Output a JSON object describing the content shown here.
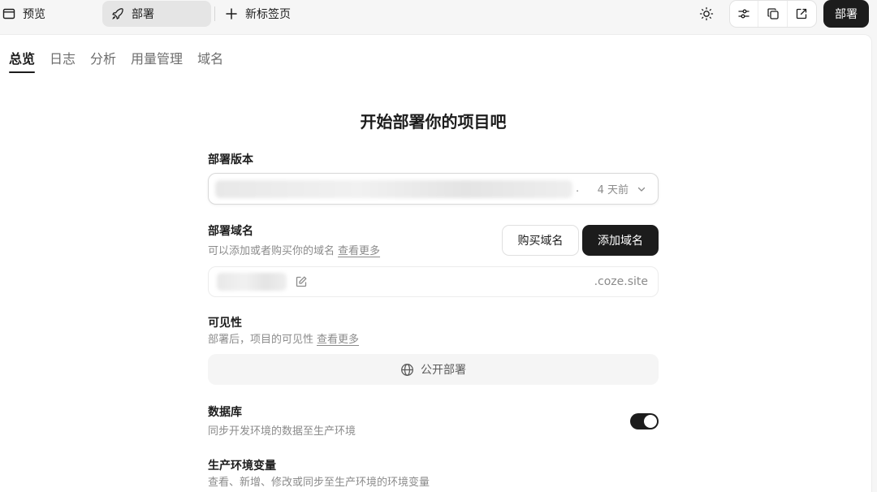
{
  "topbar": {
    "tabs": [
      {
        "label": "预览",
        "icon": "browser-window-icon"
      },
      {
        "label": "部署",
        "icon": "rocket-icon"
      },
      {
        "label": "新标签页",
        "icon": "plus-icon"
      }
    ],
    "actions": [
      "sun-icon",
      "sliders-icon",
      "copy-icon",
      "external-link-icon"
    ],
    "deploy_label": "部署"
  },
  "subtabs": [
    {
      "label": "总览",
      "active": true
    },
    {
      "label": "日志"
    },
    {
      "label": "分析"
    },
    {
      "label": "用量管理"
    },
    {
      "label": "域名"
    }
  ],
  "main": {
    "heading": "开始部署你的项目吧",
    "version": {
      "label": "部署版本",
      "ellipsis": ".",
      "time": "4 天前"
    },
    "domain": {
      "label": "部署域名",
      "desc": "可以添加或者购买你的域名",
      "more": "查看更多",
      "buy_label": "购买域名",
      "add_label": "添加域名",
      "suffix": ".coze.site"
    },
    "visibility": {
      "label": "可见性",
      "desc": "部署后，项目的可见性",
      "more": "查看更多",
      "option": "公开部署"
    },
    "database": {
      "label": "数据库",
      "desc": "同步开发环境的数据至生产环境",
      "enabled": true
    },
    "env": {
      "label": "生产环境变量",
      "desc": "查看、新增、修改或同步至生产环境的环境变量"
    }
  },
  "colors": {
    "accent": "#1c1c1c",
    "muted_text": "#8b8b8b",
    "background": "#f6f6f6"
  }
}
